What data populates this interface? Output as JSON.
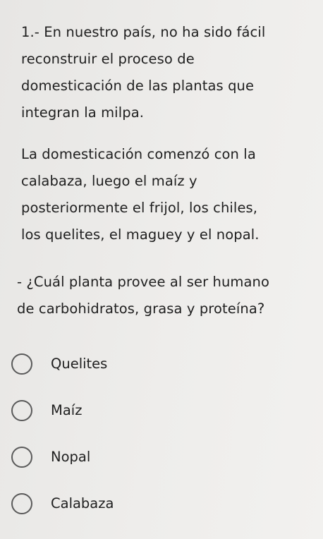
{
  "question": {
    "title_lines": [
      "1.- En nuestro país, no ha sido fácil",
      "reconstruir el proceso de",
      "domesticación de las plantas que",
      "integran la milpa."
    ],
    "context_lines": [
      "La domesticación comenzó con la",
      "calabaza, luego el maíz y",
      "posteriormente el frijol, los chiles,",
      "los quelites, el maguey y el nopal."
    ],
    "prompt_lines": [
      "- ¿Cuál planta provee al ser humano",
      "de carbohidratos, grasa y proteína?"
    ]
  },
  "options": [
    {
      "label": "Quelites",
      "selected": false
    },
    {
      "label": "Maíz",
      "selected": false
    },
    {
      "label": "Nopal",
      "selected": false
    },
    {
      "label": "Calabaza",
      "selected": false
    }
  ]
}
